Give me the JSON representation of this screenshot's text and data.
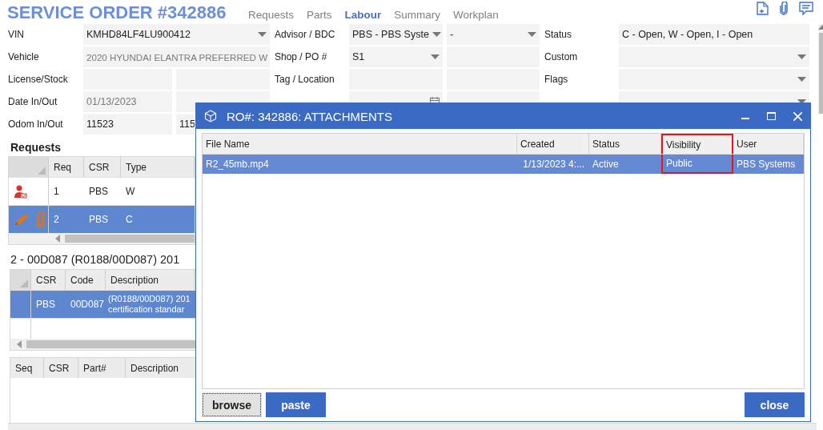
{
  "header": {
    "title": "SERVICE ORDER #342886",
    "tabs": [
      {
        "label": "Requests",
        "selected": false
      },
      {
        "label": "Parts",
        "selected": false
      },
      {
        "label": "Labour",
        "selected": true
      },
      {
        "label": "Summary",
        "selected": false
      },
      {
        "label": "Workplan",
        "selected": false
      }
    ]
  },
  "form": {
    "groups": [
      {
        "rows": [
          {
            "label": "VIN",
            "fields": [
              {
                "kind": "wide-dropdown",
                "text": "KMHD84LF4LU900412",
                "disabled": false
              }
            ]
          },
          {
            "label": "Vehicle",
            "fields": [
              {
                "kind": "wide-text",
                "text": "2020 HYUNDAI ELANTRA PREFERRED W",
                "disabled": true
              }
            ]
          },
          {
            "label": "License/Stock",
            "fields": [
              {
                "kind": "text"
              },
              {
                "kind": "text"
              }
            ]
          },
          {
            "label": "Date In/Out",
            "fields": [
              {
                "kind": "text",
                "text": "01/13/2023",
                "disabled": true
              },
              {
                "kind": "text"
              }
            ]
          },
          {
            "label": "Odom In/Out",
            "fields": [
              {
                "kind": "text",
                "text": "11523",
                "disabled": false
              },
              {
                "kind": "edge-text",
                "text": "115",
                "disabled": false
              }
            ]
          }
        ]
      },
      {
        "rows": [
          {
            "label": "Advisor / BDC",
            "fields": [
              {
                "kind": "dropdown",
                "text": "PBS - PBS Syste",
                "disabled": false
              },
              {
                "kind": "dropdown",
                "text": "-",
                "disabled": false
              }
            ]
          },
          {
            "label": "Shop / PO #",
            "fields": [
              {
                "kind": "dropdown",
                "text": "S1",
                "disabled": false
              },
              {
                "kind": "text"
              }
            ]
          },
          {
            "label": "Tag / Location",
            "fields": [
              {
                "kind": "text"
              },
              {
                "kind": "text"
              }
            ]
          },
          {
            "fields": [
              {
                "kind": "date"
              },
              {
                "kind": "text"
              }
            ]
          }
        ]
      },
      {
        "rows": [
          {
            "label": "Status",
            "fields": [
              {
                "kind": "text",
                "text": "C - Open, W - Open, I - Open",
                "disabled": false
              }
            ]
          },
          {
            "label": "Custom",
            "fields": [
              {
                "kind": "dropdown"
              }
            ]
          },
          {
            "label": "Flags",
            "fields": [
              {
                "kind": "dropdown"
              }
            ]
          },
          {
            "fields": [
              {
                "kind": "dropdown"
              }
            ]
          }
        ]
      }
    ]
  },
  "requests": {
    "title": "Requests",
    "columns": [
      "Req",
      "CSR",
      "Type"
    ],
    "rows": [
      {
        "kind": "person",
        "attachment": false,
        "cells": [
          "1",
          "PBS",
          "W"
        ],
        "selected": false
      },
      {
        "kind": "pencil",
        "attachment": true,
        "cells": [
          "2",
          "PBS",
          "C"
        ],
        "selected": true
      }
    ]
  },
  "labour": {
    "title": "2 - 00D087 (R0188/00D087) 201",
    "columns": [
      "CSR",
      "Code",
      "Description"
    ],
    "rows": [
      {
        "cells": [
          "PBS",
          "00D087"
        ],
        "description": [
          "(R0188/00D087) 201",
          "certification standar"
        ],
        "selected": true
      }
    ]
  },
  "parts": {
    "columns": [
      "Seq",
      "CSR",
      "Part#",
      "Description"
    ]
  },
  "dialog": {
    "title": "RO#: 342886: ATTACHMENTS",
    "columns": [
      {
        "label": "File Name",
        "highlighted": false
      },
      {
        "label": "Created",
        "highlighted": false
      },
      {
        "label": "Status",
        "highlighted": false
      },
      {
        "label": "Visibility",
        "highlighted": true
      },
      {
        "label": "User",
        "highlighted": false
      }
    ],
    "rows": [
      {
        "cells": [
          "R2_45mb.mp4",
          "1/13/2023 4:...",
          "Active",
          "Public",
          "PBS Systems"
        ],
        "selected": true
      }
    ],
    "left_buttons": [
      {
        "label": "browse",
        "kind": "secondary",
        "focused": true
      },
      {
        "label": "paste",
        "kind": "primary",
        "focused": false
      }
    ],
    "right_buttons": [
      {
        "label": "close",
        "kind": "primary",
        "focused": false
      }
    ]
  }
}
